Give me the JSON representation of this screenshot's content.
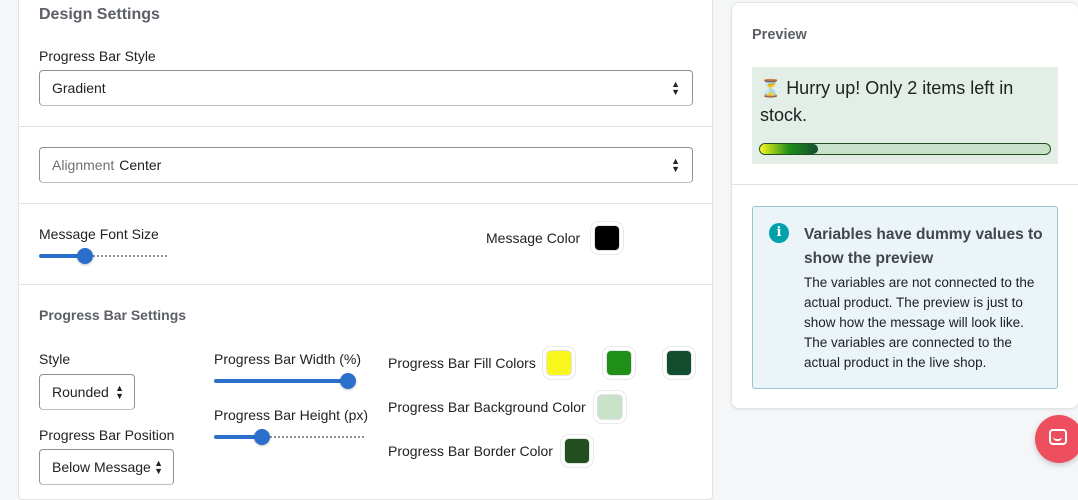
{
  "design": {
    "title": "Design Settings",
    "bar_style_label": "Progress Bar Style",
    "bar_style_value": "Gradient",
    "alignment_prefix": "Alignment",
    "alignment_value": "Center",
    "font_size_label": "Message Font Size",
    "font_size_level": 0.33,
    "message_color_label": "Message Color",
    "message_color": "#000000"
  },
  "progress_settings": {
    "title": "Progress Bar Settings",
    "style_label": "Style",
    "style_value": "Rounded",
    "position_label": "Progress Bar Position",
    "position_value": "Below Message",
    "width_label": "Progress Bar Width (%)",
    "width_level": 1.0,
    "height_label": "Progress Bar Height (px)",
    "height_level": 0.3,
    "fill_colors_label": "Progress Bar Fill Colors",
    "fill_colors": [
      "#f8f61a",
      "#1f8f18",
      "#134d2f"
    ],
    "bg_color_label": "Progress Bar Background Color",
    "bg_color": "#c7e2c9",
    "border_color_label": "Progress Bar Border Color",
    "border_color": "#214f1e"
  },
  "preview": {
    "title": "Preview",
    "icon": "hourglass-icon",
    "message": "Hurry up! Only 2 items left in stock.",
    "progress": 0.2,
    "background": "#e3eee6"
  },
  "info_banner": {
    "icon": "info-icon",
    "title": "Variables have dummy values to show the preview",
    "body": "The variables are not connected to the actual product. The preview is just to show how the message will look like. The variables are connected to the actual product in the live shop."
  },
  "colors": {
    "accent": "#2c6ecb",
    "chat": "#ee4f5f"
  }
}
